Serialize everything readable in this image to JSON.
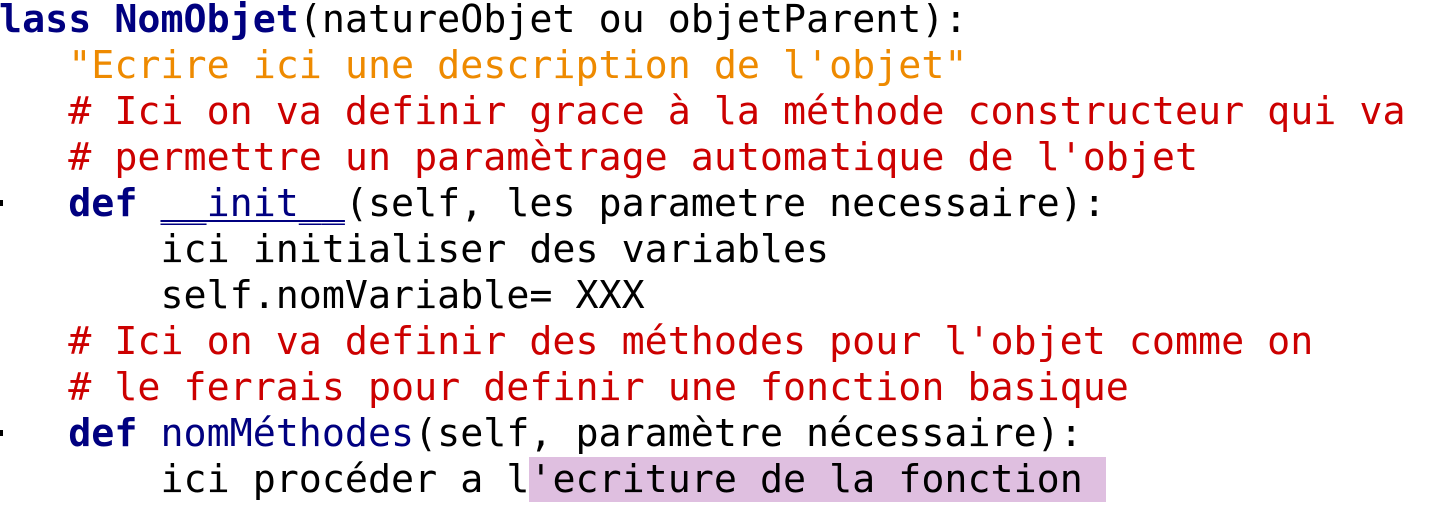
{
  "colors": {
    "keyword": "#000080",
    "string": "#ee8a00",
    "comment": "#cc0000",
    "selection": "#dfbfe0",
    "text": "#000000",
    "background": "#ffffff"
  },
  "code": {
    "line1": {
      "kw": "class",
      "sp": " ",
      "name": "NomObjet",
      "rest": "(natureObjet ou objetParent):"
    },
    "line2": {
      "indent": "    ",
      "string": "\"Ecrire ici une description de l'objet\""
    },
    "line3": {
      "indent": "    ",
      "comment": "# Ici on va definir grace à la méthode constructeur qui va"
    },
    "line4": {
      "indent": "    ",
      "comment": "# permettre un paramètrage automatique de l'objet"
    },
    "line5": {
      "indent": "    ",
      "kw": "def",
      "sp": " ",
      "fn": "__init__",
      "rest": "(self, les parametre necessaire):"
    },
    "line6": {
      "indent": "        ",
      "text": "ici initialiser des variables"
    },
    "line7": {
      "indent": "        ",
      "text": "self.nomVariable= XXX"
    },
    "line8": {
      "indent": "    ",
      "comment": "# Ici on va definir des méthodes pour l'objet comme on"
    },
    "line9": {
      "indent": "    ",
      "comment": "# le ferrais pour definir une fonction basique"
    },
    "line10": {
      "indent": "    ",
      "kw": "def",
      "sp": " ",
      "fn": "nomMéthodes",
      "rest": "(self, paramètre nécessaire):"
    },
    "line11": {
      "indent": "        ",
      "text": "ici procéder a l",
      "selected": "'ecriture de la fonction"
    }
  }
}
